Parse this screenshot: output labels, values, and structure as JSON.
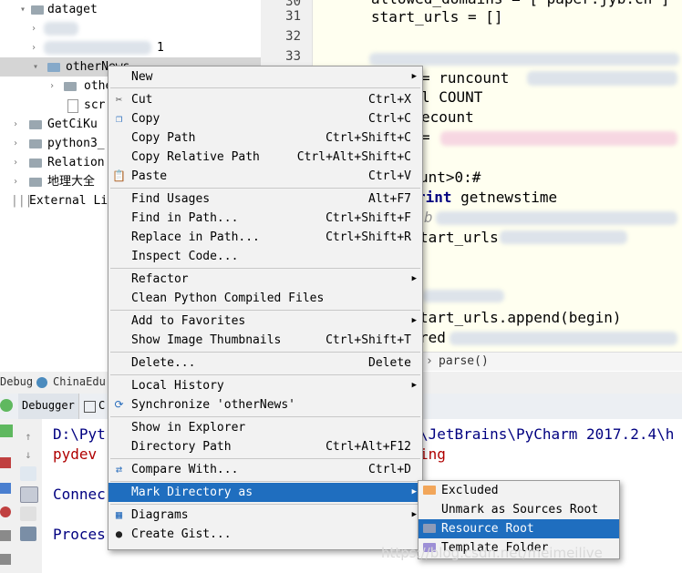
{
  "tree": {
    "items": [
      {
        "label": "dataget"
      },
      {
        "label": "1"
      },
      {
        "label": "otherNews"
      },
      {
        "label": "othe"
      },
      {
        "label": "scr"
      },
      {
        "label": "GetCiKu"
      },
      {
        "label": "python3_"
      },
      {
        "label": "Relation"
      },
      {
        "label": "地理大全"
      },
      {
        "label": "External Li"
      }
    ]
  },
  "editor": {
    "line_numbers": [
      "30",
      "31",
      "32",
      "33"
    ],
    "code": {
      "l1": "allowed_domains = [\"paper.jyb.cn\"]",
      "l2": "start_urls = []",
      "l3": "= runcount",
      "l4": "l COUNT",
      "l5": "ecount",
      "l6": "=",
      "l7": "unt>0:",
      "l7_comment": "#",
      "l8_kw": "rint",
      "l8": "getnewstime",
      "l9": "b",
      "l10": "tart_urls",
      "l11": "tart_urls.append(begin)",
      "l12": "red"
    },
    "breadcrumb": "parse()"
  },
  "toolwindow": {
    "strip_debug": "Debug",
    "strip_project": "ChinaEdu",
    "tab_debugger": "Debugger",
    "tab_console_initial": "C",
    "console": {
      "line1_left": "D:\\Pyt",
      "line1_right": "\\JetBrains\\PyCharm 2017.2.4\\h",
      "line2_left": "pydev",
      "line2_right": "ing",
      "line3": "Connec",
      "line4": "Proces"
    }
  },
  "context_menu": {
    "items": [
      {
        "label": "New",
        "shortcut": "",
        "submenu": true
      },
      {
        "label": "Cut",
        "shortcut": "Ctrl+X"
      },
      {
        "label": "Copy",
        "shortcut": "Ctrl+C"
      },
      {
        "label": "Copy Path",
        "shortcut": "Ctrl+Shift+C"
      },
      {
        "label": "Copy Relative Path",
        "shortcut": "Ctrl+Alt+Shift+C"
      },
      {
        "label": "Paste",
        "shortcut": "Ctrl+V"
      },
      {
        "label": "Find Usages",
        "shortcut": "Alt+F7"
      },
      {
        "label": "Find in Path...",
        "shortcut": "Ctrl+Shift+F"
      },
      {
        "label": "Replace in Path...",
        "shortcut": "Ctrl+Shift+R"
      },
      {
        "label": "Inspect Code...",
        "shortcut": ""
      },
      {
        "label": "Refactor",
        "shortcut": "",
        "submenu": true
      },
      {
        "label": "Clean Python Compiled Files",
        "shortcut": ""
      },
      {
        "label": "Add to Favorites",
        "shortcut": "",
        "submenu": true
      },
      {
        "label": "Show Image Thumbnails",
        "shortcut": "Ctrl+Shift+T"
      },
      {
        "label": "Delete...",
        "shortcut": "Delete"
      },
      {
        "label": "Local History",
        "shortcut": "",
        "submenu": true
      },
      {
        "label": "Synchronize 'otherNews'",
        "shortcut": ""
      },
      {
        "label": "Show in Explorer",
        "shortcut": ""
      },
      {
        "label": "Directory Path",
        "shortcut": "Ctrl+Alt+F12"
      },
      {
        "label": "Compare With...",
        "shortcut": "Ctrl+D"
      },
      {
        "label": "Mark Directory as",
        "shortcut": "",
        "submenu": true
      },
      {
        "label": "Diagrams",
        "shortcut": "",
        "submenu": true
      },
      {
        "label": "Create Gist...",
        "shortcut": ""
      }
    ],
    "submenu_arrow": "▶"
  },
  "mark_submenu": {
    "items": [
      {
        "label": "Excluded",
        "color": "#f2a65a"
      },
      {
        "label": "Unmark as Sources Root",
        "color": ""
      },
      {
        "label": "Resource Root",
        "color": "#8d9bb8"
      },
      {
        "label": "Template Folder",
        "color": "#9d8fd6"
      }
    ]
  },
  "watermark": "https://blog.csdn.net/meimeilive",
  "colors": {
    "selection": "#1f6ebf",
    "menu_bg": "#f2f2f2",
    "editor_bg": "#fffff0"
  }
}
